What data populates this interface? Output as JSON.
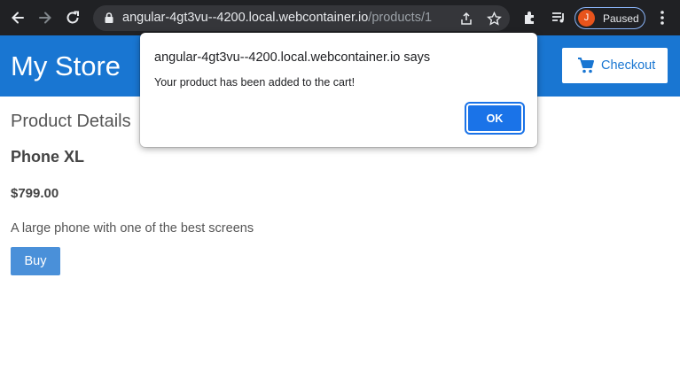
{
  "browser": {
    "url_host": "angular-4gt3vu--4200.local.webcontainer.io",
    "url_path": "/products/1",
    "profile_initial": "J",
    "profile_status": "Paused",
    "icons": [
      "back-arrow-icon",
      "forward-arrow-icon",
      "reload-icon",
      "lock-icon",
      "share-icon",
      "star-icon",
      "extensions-icon",
      "media-queue-icon",
      "kebab-menu-icon"
    ],
    "colors": {
      "chrome_bg": "#202124",
      "omnibox_bg": "#35363a",
      "avatar": "#e8541c",
      "pill_border": "#8ab4f8"
    }
  },
  "header": {
    "title": "My Store",
    "checkout_label": "Checkout",
    "checkout_icon": "shopping-cart-icon",
    "color": "#1976d2"
  },
  "product": {
    "section_title": "Product Details",
    "name": "Phone XL",
    "price": "$799.00",
    "description": "A large phone with one of the best screens",
    "buy_label": "Buy"
  },
  "dialog": {
    "origin": "angular-4gt3vu--4200.local.webcontainer.io says",
    "message": "Your product has been added to the cart!",
    "ok_label": "OK",
    "accent": "#1a73e8"
  }
}
